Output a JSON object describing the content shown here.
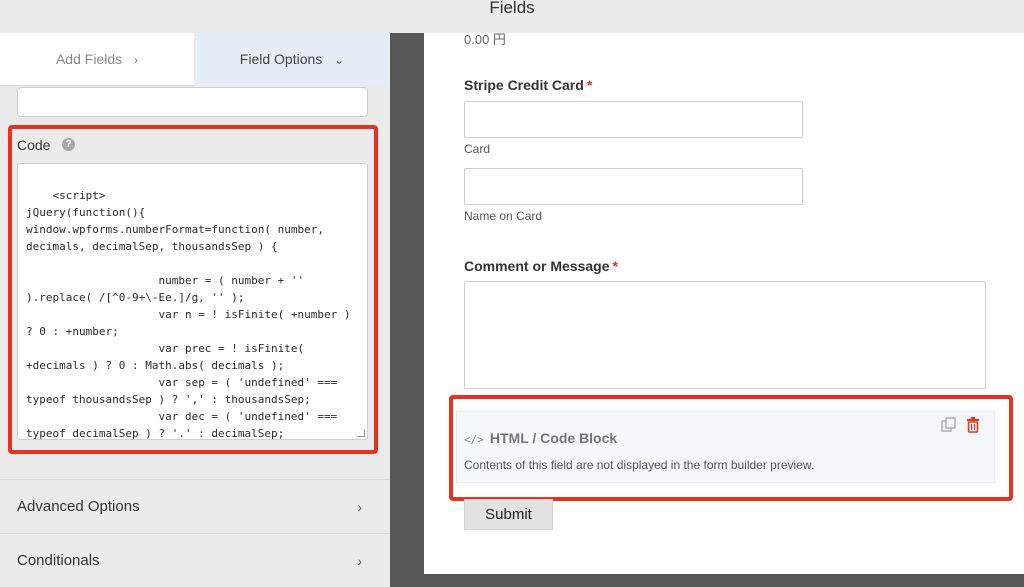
{
  "header": {
    "title": "Fields"
  },
  "left_panel": {
    "tabs": [
      {
        "label": "Add Fields",
        "chevron": "›"
      },
      {
        "label": "Field Options",
        "chevron": "⌄"
      }
    ],
    "code": {
      "label": "Code",
      "help_icon": "?",
      "value": "<script>\njQuery(function(){\nwindow.wpforms.numberFormat=function( number, decimals, decimalSep, thousandsSep ) {\n\n                    number = ( number + '' ).replace( /[^0-9+\\-Ee.]/g, '' );\n                    var n = ! isFinite( +number ) ? 0 : +number;\n                    var prec = ! isFinite( +decimals ) ? 0 : Math.abs( decimals );\n                    var sep = ( 'undefined' === typeof thousandsSep ) ? ',' : thousandsSep;\n                    var dec = ( 'undefined' === typeof decimalSep ) ? '.' : decimalSep;\n                    var s;"
    },
    "accordions": [
      {
        "label": "Advanced Options",
        "arrow": "›"
      },
      {
        "label": "Conditionals",
        "arrow": "›"
      }
    ]
  },
  "preview": {
    "price": "0.00 円",
    "fields": [
      {
        "label": "Stripe Credit Card",
        "required": "*",
        "sublabels": [
          "Card",
          "Name on Card"
        ]
      },
      {
        "label": "Comment or Message",
        "required": "*"
      }
    ],
    "html_block": {
      "icon": "</>",
      "title": "HTML / Code Block",
      "description": "Contents of this field are not displayed in the form builder preview."
    },
    "submit_label": "Submit"
  },
  "colors": {
    "highlight": "#e8321f",
    "required": "#e8321f",
    "active_tab": "#e6edf6",
    "gap": "#575757"
  }
}
